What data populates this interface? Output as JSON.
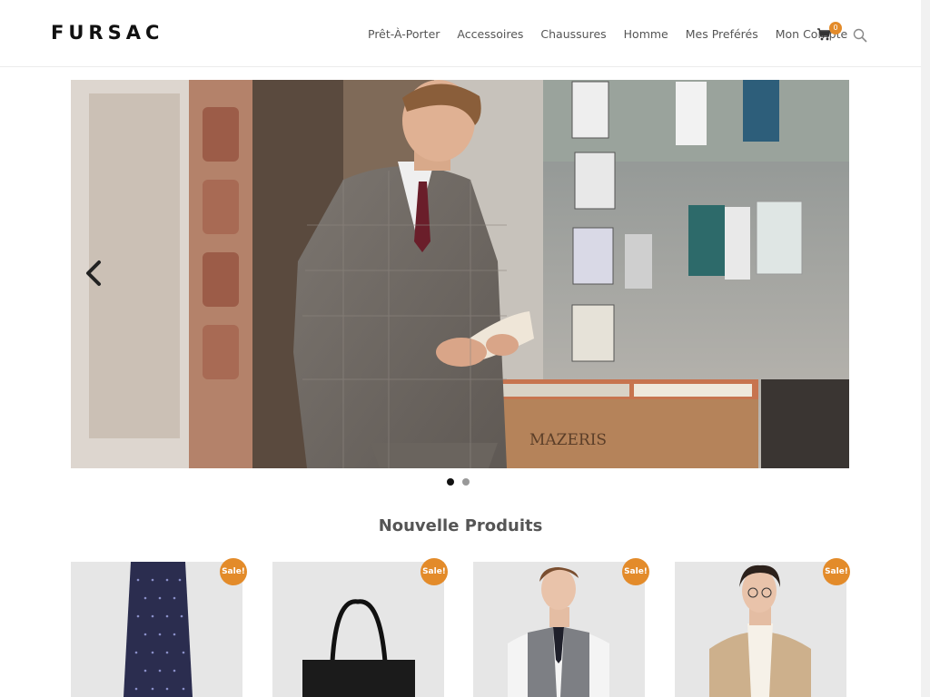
{
  "header": {
    "logo": "FURSAC",
    "nav": [
      "Prêt-À-Porter",
      "Accessoires",
      "Chaussures",
      "Homme",
      "Mes Preférés",
      "Mon Compte"
    ],
    "cart_count": "0"
  },
  "hero": {
    "sign_text": "MAZERIS",
    "slides_total": 2,
    "active_slide": 1
  },
  "section": {
    "title": "Nouvelle Produits"
  },
  "products": [
    {
      "sale_label": "Sale!",
      "icon": "tie-product-image"
    },
    {
      "sale_label": "Sale!",
      "icon": "tote-bag-product-image"
    },
    {
      "sale_label": "Sale!",
      "icon": "vest-model-product-image"
    },
    {
      "sale_label": "Sale!",
      "icon": "cardigan-model-product-image"
    }
  ],
  "colors": {
    "accent": "#e38b2a",
    "text": "#555555",
    "logo": "#111111"
  }
}
